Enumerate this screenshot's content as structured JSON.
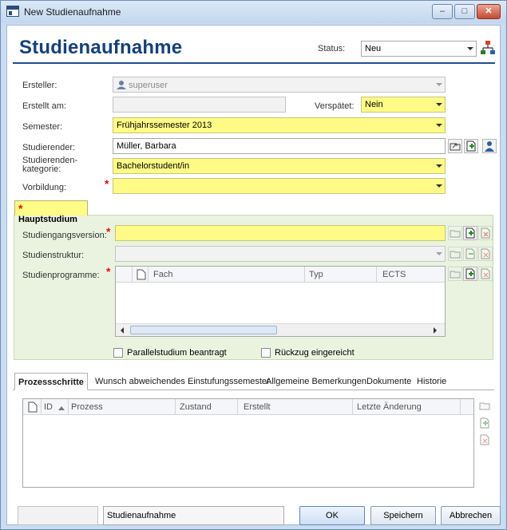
{
  "window": {
    "title": "New Studienaufnahme"
  },
  "header": {
    "title": "Studienaufnahme",
    "status_label": "Status:",
    "status_value": "Neu"
  },
  "form": {
    "ersteller": {
      "label": "Ersteller:",
      "value": "superuser"
    },
    "erstellt_am": {
      "label": "Erstellt am:",
      "value": ""
    },
    "verspaetet": {
      "label": "Verspätet:",
      "value": "Nein"
    },
    "semester": {
      "label": "Semester:",
      "value": "Frühjahrssemester 2013"
    },
    "studierender": {
      "label": "Studierender:",
      "value": "Müller, Barbara"
    },
    "kategorie": {
      "label_line1": "Studierenden-",
      "label_line2": "kategorie:",
      "value": "Bachelorstudent/in"
    },
    "vorbildung": {
      "label": "Vorbildung:",
      "value": ""
    }
  },
  "hauptstudium": {
    "tab_label": "Hauptstudium",
    "studiengangsversion": {
      "label": "Studiengangsversion:",
      "value": ""
    },
    "studienstruktur": {
      "label": "Studienstruktur:",
      "value": ""
    },
    "studienprogramme": {
      "label": "Studienprogramme:",
      "columns": [
        "Fach",
        "Typ",
        "ECTS"
      ]
    }
  },
  "checkboxes": {
    "parallel": "Parallelstudium beantragt",
    "rueckzug": "Rückzug eingereicht"
  },
  "bottom_tabs": [
    "Prozessschritte",
    "Wunsch abweichendes Einstufungssemester",
    "Allgemeine Bemerkungen",
    "Dokumente",
    "Historie"
  ],
  "process_grid": {
    "columns": [
      "ID",
      "Prozess",
      "Zustand",
      "Erstellt",
      "Letzte Änderung"
    ]
  },
  "footer": {
    "status_left": "",
    "status_text": "Studienaufnahme",
    "ok": "OK",
    "save": "Speichern",
    "cancel": "Abbrechen"
  },
  "colors": {
    "required_yellow": "#fffb86",
    "title_blue": "#15407a",
    "group_green": "#eaf3df"
  }
}
